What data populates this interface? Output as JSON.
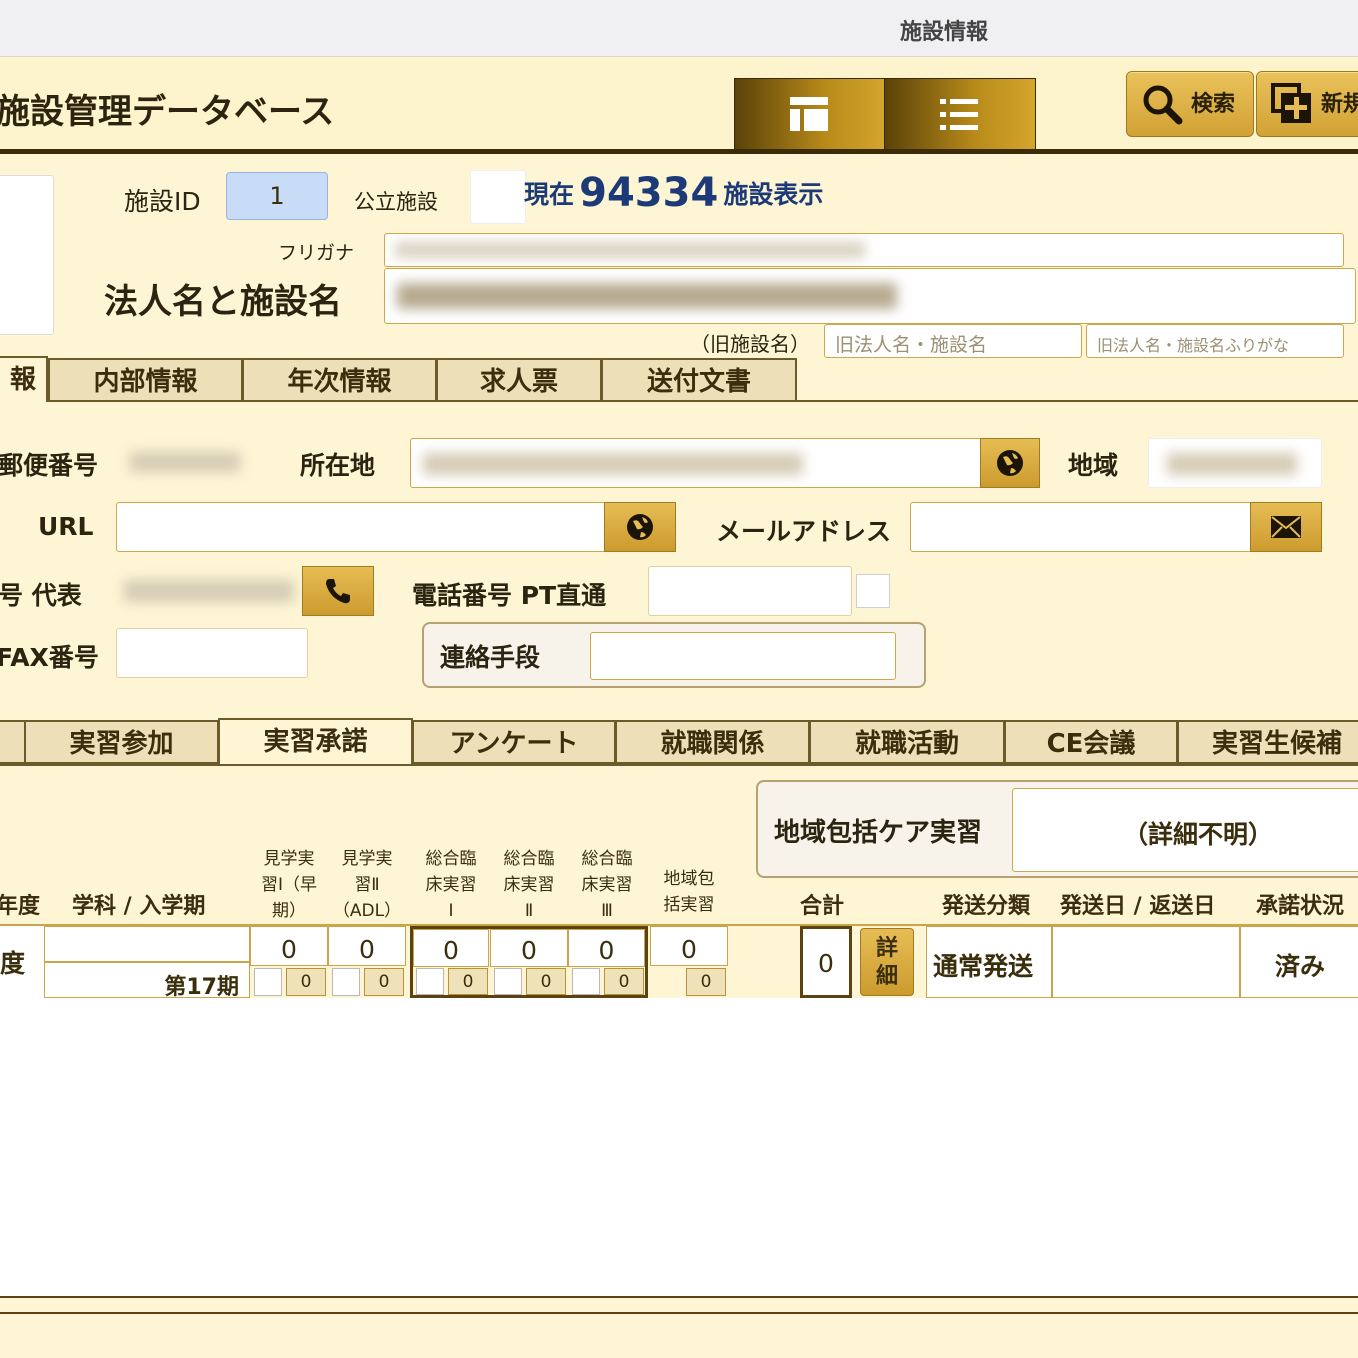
{
  "window": {
    "title": "施設情報"
  },
  "header": {
    "app_title": "施設管理データベース",
    "search_label": "検索",
    "new_label": "新規"
  },
  "record": {
    "id_label": "施設ID",
    "id_value": "1",
    "public_label": "公立施設",
    "current_prefix": "現在",
    "current_count": "94334",
    "current_suffix": "施設表示",
    "furigana_label": "フリガナ",
    "name_label": "法人名と施設名",
    "old_label": "（旧施設名）",
    "old_name_placeholder": "旧法人名・施設名",
    "old_furigana_placeholder": "旧法人名・施設名ふりがな"
  },
  "tabs1": [
    {
      "label": "報"
    },
    {
      "label": "内部情報"
    },
    {
      "label": "年次情報"
    },
    {
      "label": "求人票"
    },
    {
      "label": "送付文書"
    }
  ],
  "contact": {
    "postal_label": "郵便番号",
    "address_label": "所在地",
    "region_label": "地域",
    "url_label": "URL",
    "email_label": "メールアドレス",
    "phone_label": "号 代表",
    "pt_phone_label": "電話番号 PT直通",
    "fax_label": "FAX番号",
    "contact_method_label": "連絡手段"
  },
  "tabs2": [
    {
      "label": "実習参加"
    },
    {
      "label": "実習承諾"
    },
    {
      "label": "アンケート"
    },
    {
      "label": "就職関係"
    },
    {
      "label": "就職活動"
    },
    {
      "label": "CE会議"
    },
    {
      "label": "実習生候補"
    }
  ],
  "practice": {
    "community_label": "地域包括ケア実習",
    "community_value": "（詳細不明）",
    "headers": {
      "year": "年度",
      "dept": "学科 / 入学期",
      "obs1": [
        "見学実",
        "習Ⅰ（早",
        "期）"
      ],
      "obs2": [
        "見学実",
        "習Ⅱ",
        "（ADL）"
      ],
      "cl1": [
        "総合臨",
        "床実習",
        "Ⅰ"
      ],
      "cl2": [
        "総合臨",
        "床実習",
        "Ⅱ"
      ],
      "cl3": [
        "総合臨",
        "床実習",
        "Ⅲ"
      ],
      "comm": [
        "地域包",
        "括実習"
      ],
      "total": "合計",
      "send_type": "発送分類",
      "send_date": "発送日 / 返送日",
      "status": "承諾状況"
    },
    "row": {
      "year": "度",
      "term": "第17期",
      "values": [
        "0",
        "0",
        "0",
        "0",
        "0",
        "0"
      ],
      "sub_values": [
        "0",
        "0",
        "0",
        "0",
        "0",
        "0"
      ],
      "total": "0",
      "detail_label": [
        "詳",
        "細"
      ],
      "send_type": "通常発送",
      "status": "済み"
    }
  },
  "colors": {
    "accent": "#d4a62c",
    "dark": "#3b2d08",
    "background": "#fdf5d4",
    "id_field": "#c9dcf7",
    "current": "#1c3a78"
  }
}
